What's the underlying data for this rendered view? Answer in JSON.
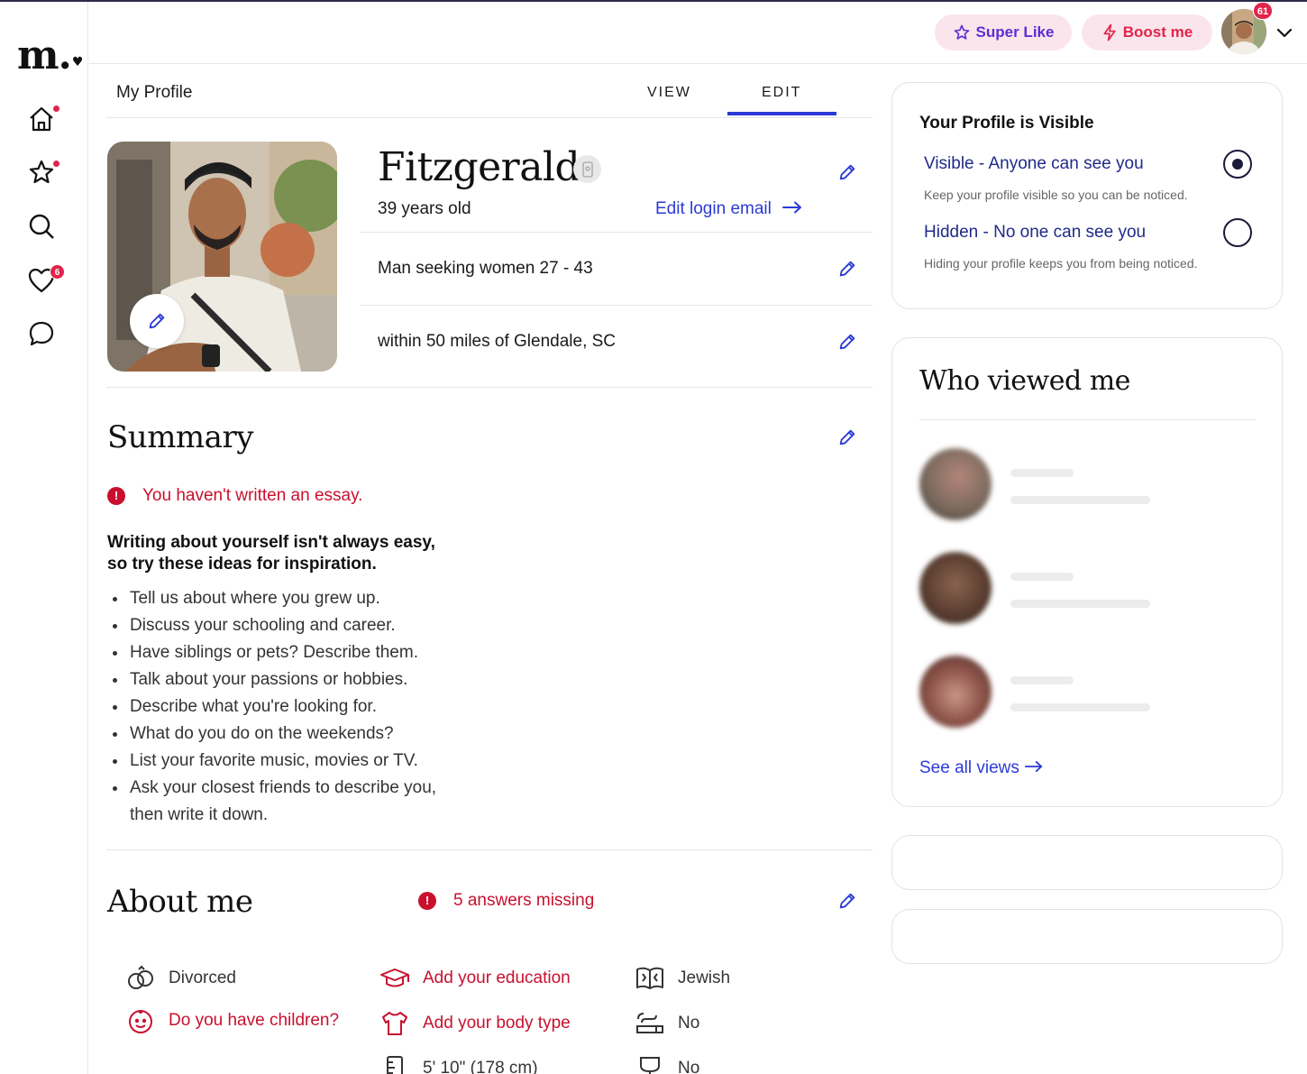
{
  "app": {
    "logo": "m."
  },
  "nav": {
    "items": [
      {
        "name": "home",
        "badge": ""
      },
      {
        "name": "favorites",
        "badge": ""
      },
      {
        "name": "search",
        "badge": ""
      },
      {
        "name": "likes",
        "badge": "6"
      },
      {
        "name": "messages",
        "badge": ""
      }
    ]
  },
  "header": {
    "super_like": "Super Like",
    "boost": "Boost me",
    "avatar_badge": "61"
  },
  "tabs": {
    "title": "My Profile",
    "view": "VIEW",
    "edit": "EDIT"
  },
  "profile": {
    "name": "Fitzgerald",
    "age": "39 years old",
    "edit_email": "Edit login email",
    "seeking": "Man seeking women 27 - 43",
    "location": "within 50 miles of Glendale, SC"
  },
  "summary": {
    "title": "Summary",
    "warning": "You haven't written an essay.",
    "tips_heading_1": "Writing about yourself isn't always easy,",
    "tips_heading_2": "so try these ideas for inspiration.",
    "tips": [
      "Tell us about where you grew up.",
      "Discuss your schooling and career.",
      "Have siblings or pets? Describe them.",
      "Talk about your passions or hobbies.",
      "Describe what you're looking for.",
      "What do you do on the weekends?",
      "List your favorite music, movies or TV.",
      "Ask your closest friends to describe you, then write it down."
    ]
  },
  "about": {
    "title": "About me",
    "warning": "5 answers missing",
    "marital": "Divorced",
    "education": "Add your education",
    "religion": "Jewish",
    "children": "Do you have children?",
    "body_type": "Add your body type",
    "smoking": "No",
    "height": "5' 10\" (178 cm)",
    "drinking": "No"
  },
  "visibility": {
    "title": "Your Profile is Visible",
    "visible_label": "Visible - Anyone can see you",
    "visible_sub": "Keep your profile visible so you can be noticed.",
    "hidden_label": "Hidden - No one can see you",
    "hidden_sub": "Hiding your profile keeps you from being noticed.",
    "selected": "visible"
  },
  "viewers": {
    "title": "Who viewed me",
    "see_all": "See all views"
  },
  "colors": {
    "accent": "#2b3ad6",
    "alert": "#c8102e",
    "brand_red": "#e0244b"
  }
}
